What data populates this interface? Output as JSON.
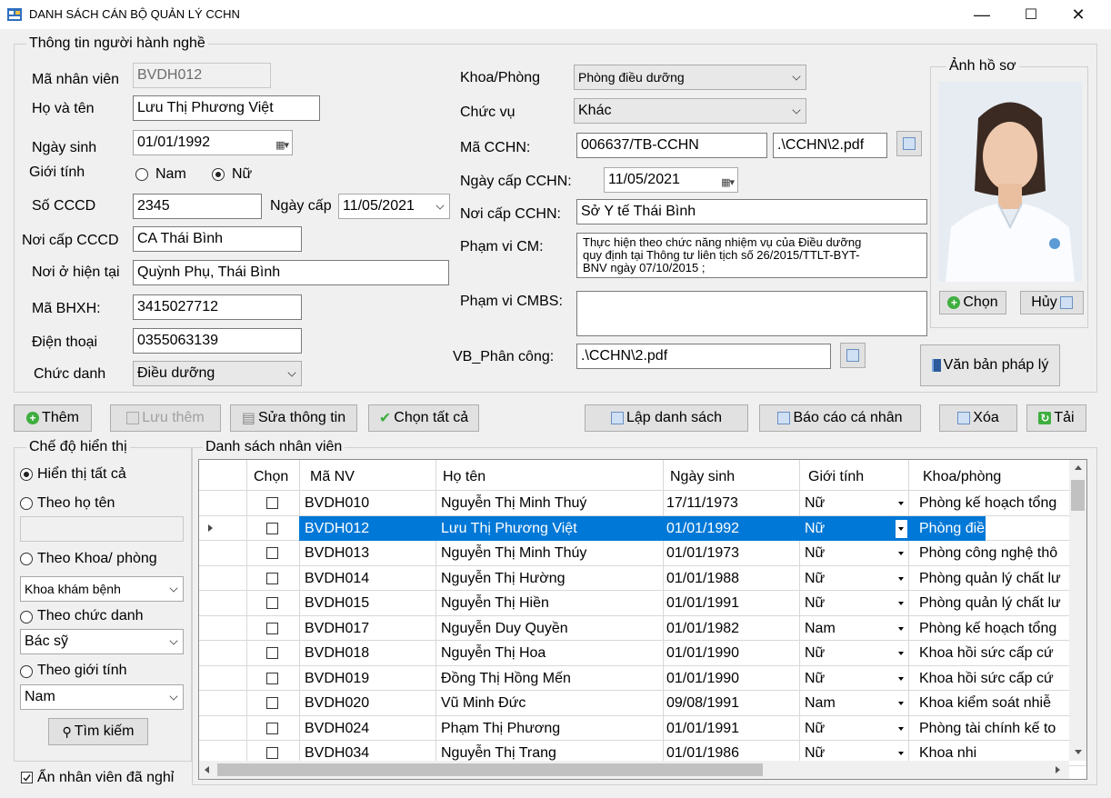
{
  "window": {
    "title": "DANH SÁCH CÁN BỘ QUẢN LÝ CCHN",
    "minimize": "—",
    "maximize": "☐",
    "close": "✕"
  },
  "info": {
    "legend": "Thông tin người hành nghề",
    "ma_nv_label": "Mã nhân viên",
    "ma_nv": "BVDH012",
    "ho_ten_label": "Họ và tên",
    "ho_ten": "Lưu Thị Phương Việt",
    "ngay_sinh_label": "Ngày sinh",
    "ngay_sinh": "01/01/1992",
    "gioi_tinh_label": "Giới tính",
    "nam": "Nam",
    "nu": "Nữ",
    "cccd_label": "Số CCCD",
    "cccd": "2345",
    "ngay_cap_label": "Ngày cấp",
    "ngay_cap": "11/05/2021",
    "noi_cap_cccd_label": "Nơi cấp CCCD",
    "noi_cap_cccd": "CA Thái Bình",
    "noi_o_label": "Nơi ở hiện tại",
    "noi_o": "Quỳnh Phụ, Thái Bình",
    "bhxh_label": "Mã BHXH:",
    "bhxh": "3415027712",
    "dien_thoai_label": "Điện thoại",
    "dien_thoai": "0355063139",
    "chuc_danh_label": "Chức danh",
    "chuc_danh": "Điều dưỡng",
    "khoa_label": "Khoa/Phòng",
    "khoa": "Phòng điều dưỡng",
    "chuc_vu_label": "Chức vụ",
    "chuc_vu": "Khác",
    "ma_cchn_label": "Mã CCHN:",
    "ma_cchn": "006637/TB-CCHN",
    "cchn_file": ".\\CCHN\\2.pdf",
    "ngay_cap_cchn_label": "Ngày cấp CCHN:",
    "ngay_cap_cchn": "11/05/2021",
    "noi_cap_cchn_label": "Nơi cấp CCHN:",
    "noi_cap_cchn": "Sở Y tế Thái Bình",
    "pham_vi_label": "Phạm vi CM:",
    "pham_vi_l1": "Thực hiện theo chức năng nhiệm vụ của Điều dưỡng",
    "pham_vi_l2": "quy định tại Thông tư liên tịch số 26/2015/TTLT-BYT-",
    "pham_vi_l3": "BNV ngày 07/10/2015 ;",
    "pham_vi_cmbs_label": "Phạm vi CMBS:",
    "pham_vi_cmbs": "",
    "vb_label": "VB_Phân công:",
    "vb": ".\\CCHN\\2.pdf",
    "photo_legend": "Ảnh hồ sơ",
    "chon_btn": "Chọn",
    "huy_btn": "Hủy",
    "vanban_btn": "Văn bản pháp lý"
  },
  "toolbar": {
    "them": "Thêm",
    "luu_them": "Lưu thêm",
    "sua": "Sửa thông tin",
    "chon_tat_ca": "Chọn tất cả",
    "lap_ds": "Lập danh sách",
    "bao_cao": "Báo cáo cá nhân",
    "xoa": "Xóa",
    "tai": "Tải"
  },
  "filter": {
    "legend": "Chế độ hiển thị",
    "all": "Hiển thị tất cả",
    "by_name": "Theo họ tên",
    "name_value": "",
    "by_khoa": "Theo Khoa/ phòng",
    "khoa_value": "Khoa khám bệnh",
    "by_chuc_danh": "Theo chức danh",
    "chuc_danh_value": "Bác sỹ",
    "by_gioi_tinh": "Theo giới tính",
    "gioi_tinh_value": "Nam",
    "search_btn": "Tìm kiếm",
    "hide_label": "Ẩn nhân viên đã nghỉ"
  },
  "table": {
    "legend": "Danh sách nhân viên",
    "headers": {
      "chon": "Chọn",
      "ma": "Mã NV",
      "ten": "Họ tên",
      "ngay": "Ngày sinh",
      "gt": "Giới tính",
      "khoa": "Khoa/phòng"
    },
    "rows": [
      {
        "ma": "BVDH010",
        "ten": "Nguyễn Thị Minh Thuý",
        "ngay": "17/11/1973",
        "gt": "Nữ",
        "khoa": "Phòng kế hoạch tổng"
      },
      {
        "ma": "BVDH012",
        "ten": "Lưu Thị Phương Việt",
        "ngay": "01/01/1992",
        "gt": "Nữ",
        "khoa": "Phòng điều dưỡng"
      },
      {
        "ma": "BVDH013",
        "ten": "Nguyễn Thị Minh Thúy",
        "ngay": "01/01/1973",
        "gt": "Nữ",
        "khoa": "Phòng công nghệ thô"
      },
      {
        "ma": "BVDH014",
        "ten": "Nguyễn Thị Hường",
        "ngay": "01/01/1988",
        "gt": "Nữ",
        "khoa": "Phòng quản lý chất lư"
      },
      {
        "ma": "BVDH015",
        "ten": "Nguyễn Thị Hiền",
        "ngay": "01/01/1991",
        "gt": "Nữ",
        "khoa": "Phòng quản lý chất lư"
      },
      {
        "ma": "BVDH017",
        "ten": "Nguyễn Duy Quyền",
        "ngay": "01/01/1982",
        "gt": "Nam",
        "khoa": "Phòng kế hoạch tổng"
      },
      {
        "ma": "BVDH018",
        "ten": "Nguyễn Thị Hoa",
        "ngay": "01/01/1990",
        "gt": "Nữ",
        "khoa": "Khoa hồi sức cấp cứ"
      },
      {
        "ma": "BVDH019",
        "ten": "Đồng Thị Hồng Mến",
        "ngay": "01/01/1990",
        "gt": "Nữ",
        "khoa": "Khoa hồi sức cấp cứ"
      },
      {
        "ma": "BVDH020",
        "ten": "Vũ Minh Đức",
        "ngay": "09/08/1991",
        "gt": "Nam",
        "khoa": "Khoa kiểm soát nhiễ"
      },
      {
        "ma": "BVDH024",
        "ten": "Phạm Thị Phương",
        "ngay": "01/01/1991",
        "gt": "Nữ",
        "khoa": "Phòng tài chính kế to"
      },
      {
        "ma": "BVDH034",
        "ten": "Nguyễn Thị Trang",
        "ngay": "01/01/1986",
        "gt": "Nữ",
        "khoa": "Khoa nhi"
      }
    ]
  }
}
